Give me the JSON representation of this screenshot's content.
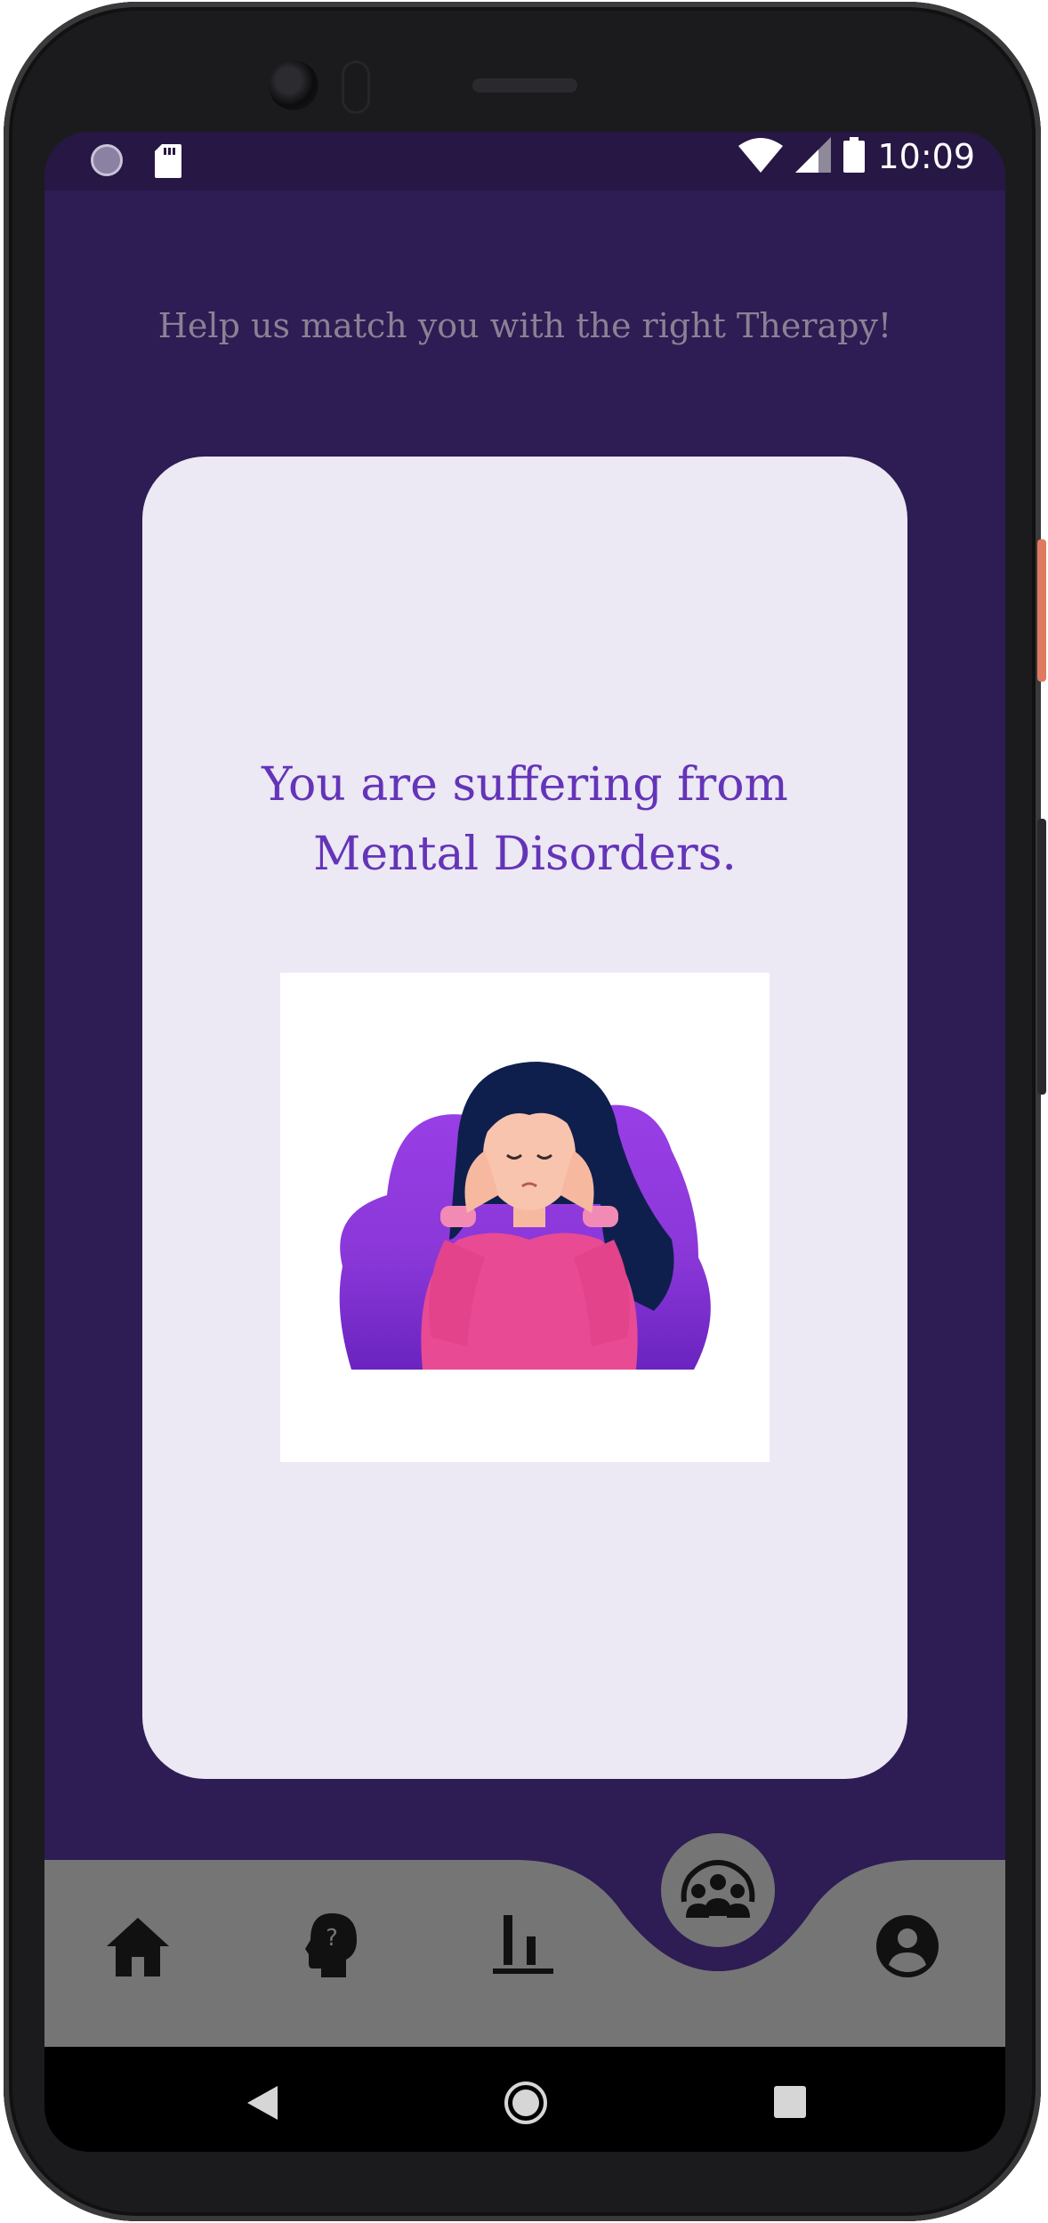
{
  "status_bar": {
    "time": "10:09",
    "icons": [
      "circle-status-icon",
      "sd-card-icon",
      "wifi-icon",
      "signal-icon",
      "battery-icon"
    ]
  },
  "header": {
    "subtitle": "Help us match you with the right Therapy!"
  },
  "result_card": {
    "title_line1": "You are suffering from",
    "title_line2": "Mental Disorders.",
    "illustration": "woman-headache-illustration"
  },
  "bottom_nav": {
    "items": [
      {
        "icon": "home-icon"
      },
      {
        "icon": "head-question-icon"
      },
      {
        "icon": "bar-chart-icon"
      },
      {
        "icon": "group-icon",
        "active": true
      },
      {
        "icon": "profile-icon"
      }
    ]
  },
  "system_nav": [
    "back-icon",
    "home-circle-icon",
    "recents-icon"
  ],
  "colors": {
    "background": "#2e1c54",
    "status_bar": "#261744",
    "card": "#ece8f4",
    "accent_text": "#6434b8",
    "subtitle_text": "#8c8094",
    "nav_bar": "#757575"
  }
}
